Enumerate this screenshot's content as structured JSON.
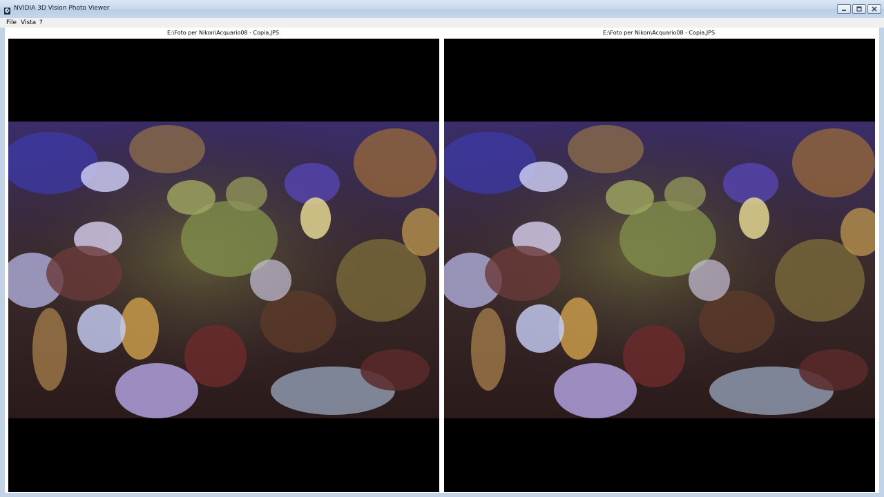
{
  "window": {
    "title": "NVIDIA 3D Vision Photo Viewer",
    "icon": "nvidia-3d-vision-icon",
    "controls": [
      "minimize-icon",
      "maximize-icon",
      "close-icon"
    ]
  },
  "menu": {
    "items": [
      {
        "label": "File"
      },
      {
        "label": "Vista"
      },
      {
        "label": "?"
      }
    ]
  },
  "viewer": {
    "left": {
      "filename": "E:\\Foto per Nikon\\Acquario08 - Copia.JPS"
    },
    "right": {
      "filename": "E:\\Foto per Nikon\\Acquario08 - Copia.JPS"
    },
    "background": "#000000"
  },
  "colors": {
    "titlebar": "#c9daee",
    "menubar": "#f0f0f0",
    "frame": "#c2d3e7"
  }
}
